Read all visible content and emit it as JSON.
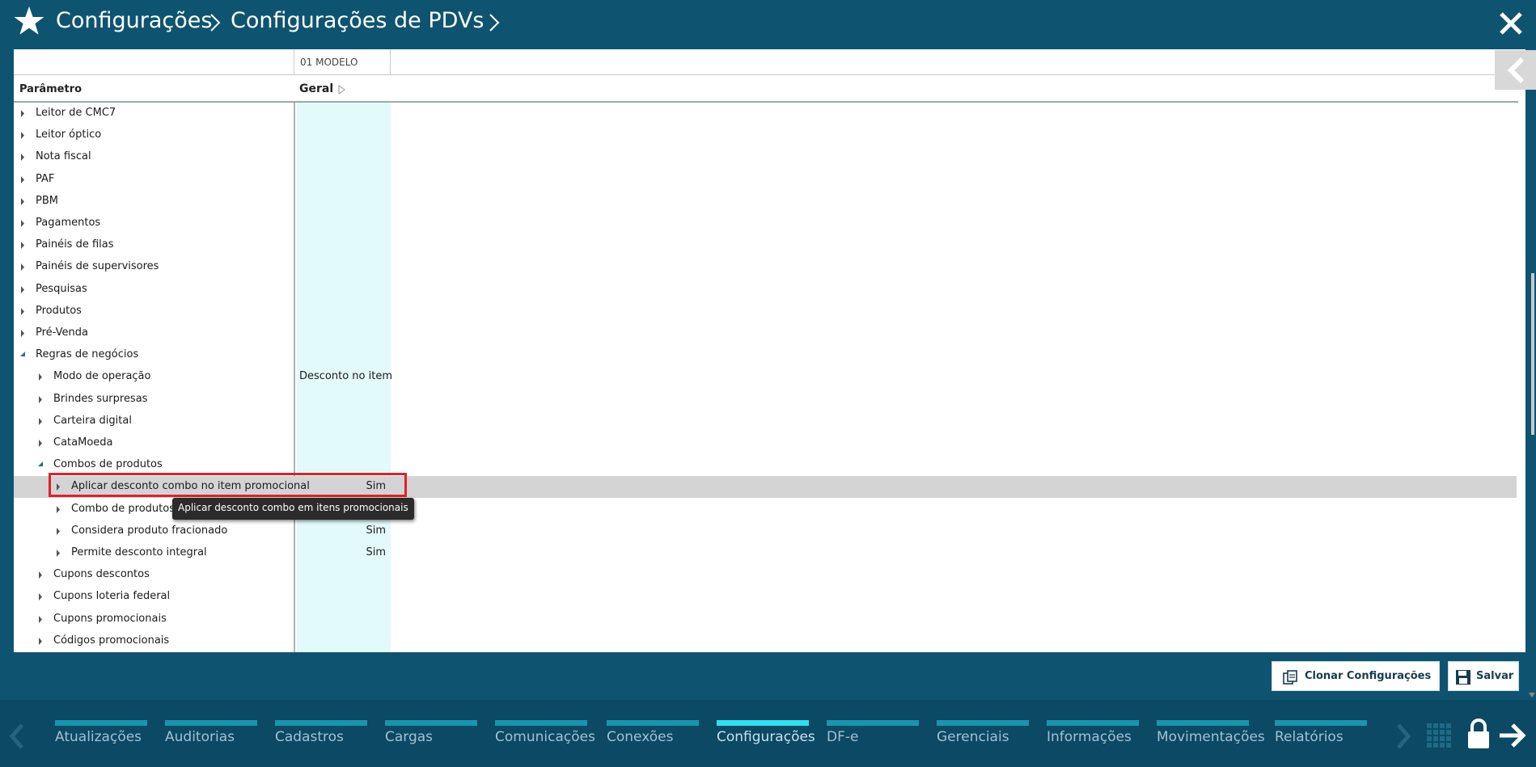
{
  "header": {
    "breadcrumb": [
      "Configurações",
      "Configurações de PDVs"
    ]
  },
  "grid": {
    "column_group": "01 MODELO",
    "param_header": "Parâmetro",
    "geral_header": "Geral",
    "rows": [
      {
        "label": "Leitor de CMC7",
        "value": "",
        "level": 0,
        "expanded": false
      },
      {
        "label": "Leitor óptico",
        "value": "",
        "level": 0,
        "expanded": false
      },
      {
        "label": "Nota fiscal",
        "value": "",
        "level": 0,
        "expanded": false
      },
      {
        "label": "PAF",
        "value": "",
        "level": 0,
        "expanded": false
      },
      {
        "label": "PBM",
        "value": "",
        "level": 0,
        "expanded": false
      },
      {
        "label": "Pagamentos",
        "value": "",
        "level": 0,
        "expanded": false
      },
      {
        "label": "Painéis de filas",
        "value": "",
        "level": 0,
        "expanded": false
      },
      {
        "label": "Painéis de supervisores",
        "value": "",
        "level": 0,
        "expanded": false
      },
      {
        "label": "Pesquisas",
        "value": "",
        "level": 0,
        "expanded": false
      },
      {
        "label": "Produtos",
        "value": "",
        "level": 0,
        "expanded": false
      },
      {
        "label": "Pré-Venda",
        "value": "",
        "level": 0,
        "expanded": false
      },
      {
        "label": "Regras de negócios",
        "value": "",
        "level": 0,
        "expanded": true
      },
      {
        "label": "Modo de operação",
        "value": "Desconto no item",
        "level": 1,
        "expanded": false
      },
      {
        "label": "Brindes surpresas",
        "value": "",
        "level": 1,
        "expanded": false
      },
      {
        "label": "Carteira digital",
        "value": "",
        "level": 1,
        "expanded": false
      },
      {
        "label": "CataMoeda",
        "value": "",
        "level": 1,
        "expanded": false
      },
      {
        "label": "Combos de produtos",
        "value": "",
        "level": 1,
        "expanded": true
      },
      {
        "label": "Aplicar desconto combo no item promocional",
        "value": "Sim",
        "level": 2,
        "expanded": false,
        "selected": true
      },
      {
        "label": "Combo de produtos",
        "value": "",
        "level": 2,
        "expanded": false
      },
      {
        "label": "Considera produto fracionado",
        "value": "Sim",
        "level": 2,
        "expanded": false
      },
      {
        "label": "Permite desconto integral",
        "value": "Sim",
        "level": 2,
        "expanded": false
      },
      {
        "label": "Cupons descontos",
        "value": "",
        "level": 1,
        "expanded": false
      },
      {
        "label": "Cupons loteria federal",
        "value": "",
        "level": 1,
        "expanded": false
      },
      {
        "label": "Cupons promocionais",
        "value": "",
        "level": 1,
        "expanded": false
      },
      {
        "label": "Códigos promocionais",
        "value": "",
        "level": 1,
        "expanded": false
      }
    ],
    "tooltip": "Aplicar desconto combo em itens promocionais"
  },
  "actions": {
    "clone_label": "Clonar Configurações",
    "save_label": "Salvar"
  },
  "nav": {
    "tabs": [
      "Atualizações",
      "Auditorias",
      "Cadastros",
      "Cargas",
      "Comunicações",
      "Conexões",
      "Configurações",
      "DF-e",
      "Gerenciais",
      "Informações",
      "Movimentações",
      "Relatórios"
    ],
    "active": "Configurações"
  },
  "colors": {
    "header_bg": "#0e5470",
    "nav_bg": "#0b4964",
    "tab_bar": "#1796ae",
    "tab_bar_active": "#2ee0ef",
    "geral_col_bg": "#e3fafb",
    "highlight": "#e0202a"
  },
  "icons": [
    "star-icon",
    "close-icon",
    "chevron-right-icon",
    "back-arrow-icon",
    "clone-icon",
    "save-icon",
    "grid-icon",
    "lock-icon",
    "arrow-right-icon"
  ]
}
